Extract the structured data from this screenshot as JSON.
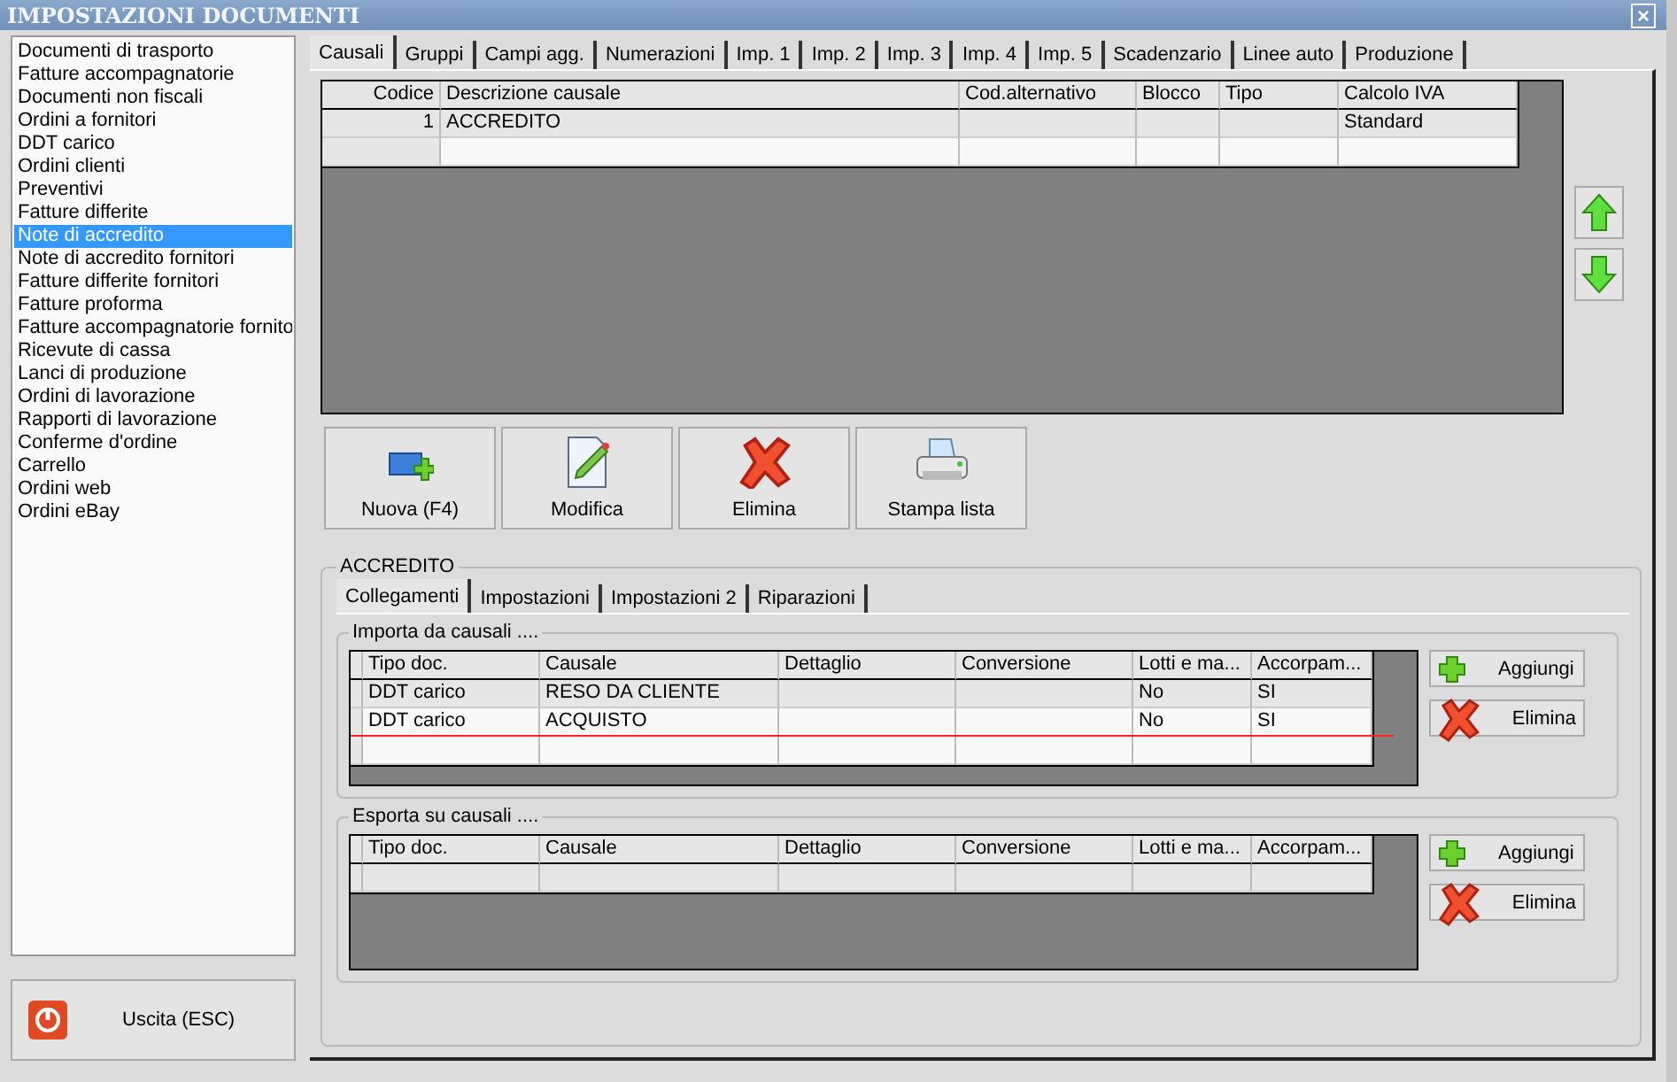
{
  "window": {
    "title": "IMPOSTAZIONI DOCUMENTI",
    "close": "×"
  },
  "sidebar": {
    "items": [
      {
        "label": "Documenti di trasporto",
        "selected": false
      },
      {
        "label": "Fatture accompagnatorie",
        "selected": false
      },
      {
        "label": "Documenti non fiscali",
        "selected": false
      },
      {
        "label": "Ordini a fornitori",
        "selected": false
      },
      {
        "label": "DDT carico",
        "selected": false
      },
      {
        "label": "Ordini clienti",
        "selected": false
      },
      {
        "label": "Preventivi",
        "selected": false
      },
      {
        "label": "Fatture differite",
        "selected": false
      },
      {
        "label": "Note di accredito",
        "selected": true
      },
      {
        "label": "Note di accredito fornitori",
        "selected": false
      },
      {
        "label": "Fatture differite fornitori",
        "selected": false
      },
      {
        "label": "Fatture proforma",
        "selected": false
      },
      {
        "label": "Fatture accompagnatorie fornito",
        "selected": false
      },
      {
        "label": "Ricevute di cassa",
        "selected": false
      },
      {
        "label": "Lanci di produzione",
        "selected": false
      },
      {
        "label": "Ordini di lavorazione",
        "selected": false
      },
      {
        "label": "Rapporti di lavorazione",
        "selected": false
      },
      {
        "label": "Conferme d'ordine",
        "selected": false
      },
      {
        "label": "Carrello",
        "selected": false
      },
      {
        "label": "Ordini web",
        "selected": false
      },
      {
        "label": "Ordini eBay",
        "selected": false
      }
    ]
  },
  "exit_button": {
    "label": "Uscita (ESC)"
  },
  "tabs": [
    {
      "label": "Causali",
      "selected": true
    },
    {
      "label": "Gruppi",
      "selected": false
    },
    {
      "label": "Campi agg.",
      "selected": false
    },
    {
      "label": "Numerazioni",
      "selected": false
    },
    {
      "label": "Imp. 1",
      "selected": false
    },
    {
      "label": "Imp. 2",
      "selected": false
    },
    {
      "label": "Imp. 3",
      "selected": false
    },
    {
      "label": "Imp. 4",
      "selected": false
    },
    {
      "label": "Imp. 5",
      "selected": false
    },
    {
      "label": "Scadenzario",
      "selected": false
    },
    {
      "label": "Linee auto",
      "selected": false
    },
    {
      "label": "Produzione",
      "selected": false
    }
  ],
  "causali_table": {
    "columns": [
      "Codice",
      "Descrizione causale",
      "Cod.alternativo",
      "Blocco",
      "Tipo",
      "Calcolo IVA"
    ],
    "rows": [
      [
        "1",
        "ACCREDITO",
        "",
        "",
        "",
        "Standard"
      ],
      [
        "",
        "",
        "",
        "",
        "",
        ""
      ]
    ]
  },
  "actions": [
    {
      "kind": "new",
      "label": "Nuova (F4)"
    },
    {
      "kind": "edit",
      "label": "Modifica"
    },
    {
      "kind": "delete",
      "label": "Elimina"
    },
    {
      "kind": "print",
      "label": "Stampa lista"
    }
  ],
  "detail": {
    "title": "ACCREDITO",
    "tabs": [
      {
        "label": "Collegamenti",
        "selected": true
      },
      {
        "label": "Impostazioni",
        "selected": false
      },
      {
        "label": "Impostazioni 2",
        "selected": false
      },
      {
        "label": "Riparazioni",
        "selected": false
      }
    ],
    "groups": [
      {
        "title": "Importa da causali ....",
        "columns": [
          "Tipo doc.",
          "Causale",
          "Dettaglio",
          "Conversione",
          "Lotti e ma...",
          "Accorpam..."
        ],
        "rows": [
          {
            "cells": [
              "DDT carico",
              "RESO DA CLIENTE",
              "",
              "",
              "No",
              "SI"
            ],
            "struck": false
          },
          {
            "cells": [
              "DDT carico",
              "ACQUISTO",
              "",
              "",
              "No",
              "SI"
            ],
            "struck": true
          },
          {
            "cells": [
              "",
              "",
              "",
              "",
              "",
              ""
            ],
            "struck": false
          }
        ],
        "buttons": [
          {
            "kind": "add",
            "label": "Aggiungi"
          },
          {
            "kind": "delete",
            "label": "Elimina"
          }
        ]
      },
      {
        "title": "Esporta su causali ....",
        "columns": [
          "Tipo doc.",
          "Causale",
          "Dettaglio",
          "Conversione",
          "Lotti e ma...",
          "Accorpam..."
        ],
        "rows": [
          {
            "cells": [
              "",
              "",
              "",
              "",
              "",
              ""
            ],
            "struck": false
          }
        ],
        "buttons": [
          {
            "kind": "add",
            "label": "Aggiungi"
          },
          {
            "kind": "delete",
            "label": "Elimina"
          }
        ]
      }
    ]
  }
}
